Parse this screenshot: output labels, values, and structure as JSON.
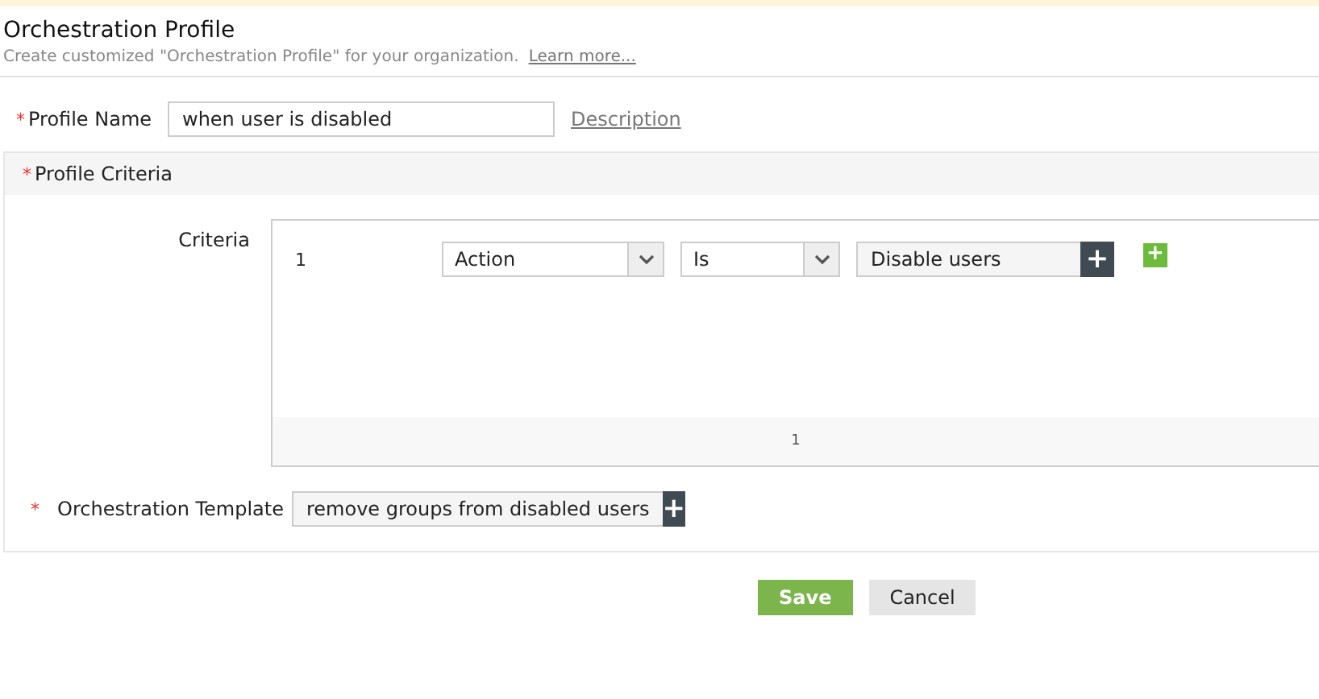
{
  "header": {
    "title": "Orchestration Profile",
    "subtitle": "Create customized \"Orchestration Profile\" for your organization.",
    "learn_more": "Learn more..."
  },
  "profile_name": {
    "required_mark": "*",
    "label": "Profile Name",
    "value": "when user is disabled",
    "description_link": "Description"
  },
  "section": {
    "required_mark": "*",
    "title": "Profile Criteria"
  },
  "criteria": {
    "label": "Criteria",
    "rows": [
      {
        "number": "1",
        "field": "Action",
        "operator": "Is",
        "value": "Disable users",
        "add": "+",
        "add_row": "+"
      }
    ],
    "page": "1"
  },
  "template": {
    "required_mark": "*",
    "label": "Orchestration Template",
    "value": "remove groups from disabled users",
    "add": "+"
  },
  "buttons": [
    {
      "label": "Save",
      "kind": "primary"
    },
    {
      "label": "Cancel",
      "kind": "secondary"
    }
  ]
}
